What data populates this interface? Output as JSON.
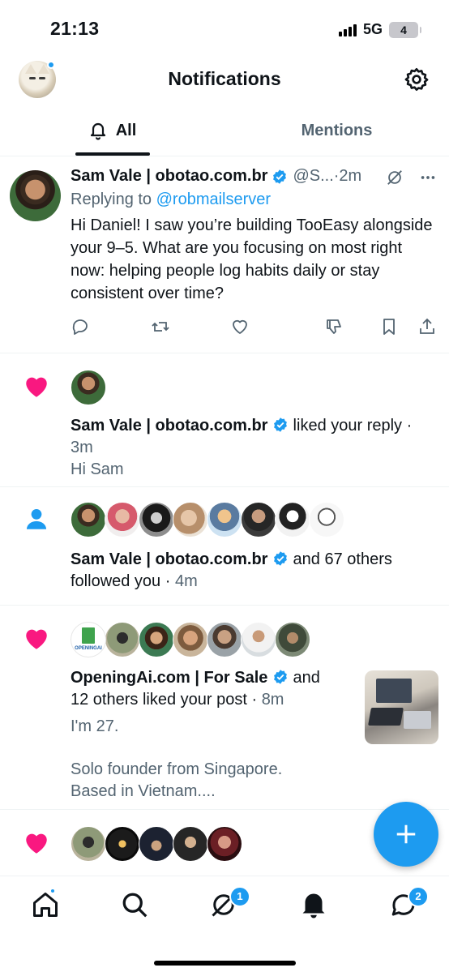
{
  "status": {
    "time": "21:13",
    "network": "5G",
    "battery": "4"
  },
  "header": {
    "title": "Notifications"
  },
  "tabs": [
    {
      "label": "All"
    },
    {
      "label": "Mentions"
    }
  ],
  "post": {
    "name": "Sam Vale | obotao.com.br",
    "handle": "@S...",
    "time": "·2m",
    "replying_prefix": "Replying to ",
    "replying_handle": "@robmailserver",
    "text": "Hi Daniel! I saw you’re building TooEasy alongside your 9–5. What are you focusing on most right now: helping people log habits daily or stay consistent over time?"
  },
  "notifications": [
    {
      "type": "like",
      "name": "Sam Vale | obotao.com.br",
      "action": " liked your reply · ",
      "time": "3m",
      "snippet": "Hi Sam"
    },
    {
      "type": "follow",
      "name": "Sam Vale | obotao.com.br",
      "action": " and 67 others",
      "action2": "followed you · ",
      "time": "4m"
    },
    {
      "type": "like",
      "name": "OpeningAi.com | For Sale",
      "action": " and",
      "action2": "12 others liked your post · ",
      "time": "8m",
      "snippet1": "I'm 27.",
      "snippet2": "Solo founder from Singapore.",
      "snippet3": "Based in Vietnam....",
      "logo_text": "OPENINGAI"
    },
    {
      "type": "like"
    }
  ],
  "nav": {
    "grok_badge": "1",
    "messages_badge": "2"
  },
  "colors": {
    "accent": "#1d9bf0",
    "like": "#f91880",
    "text": "#0f1419",
    "secondary": "#536471"
  }
}
